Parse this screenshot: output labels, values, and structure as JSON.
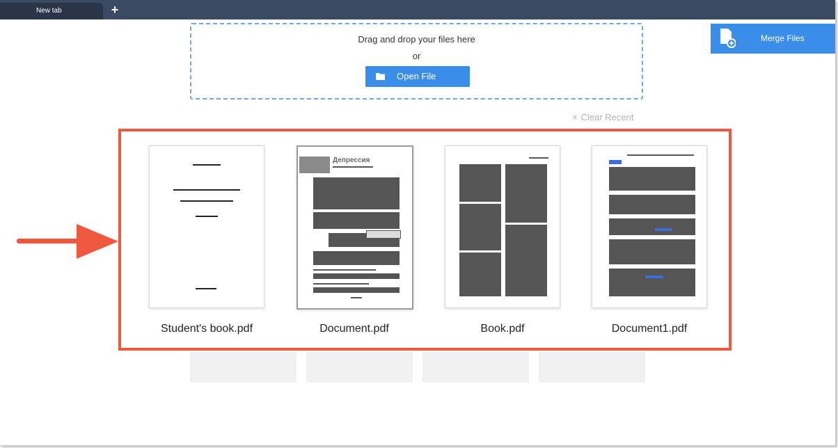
{
  "tabs": [
    {
      "label": "New tab"
    }
  ],
  "tab_add_label": "+",
  "dropzone": {
    "line1": "Drag and drop your files here",
    "line2": "or",
    "open_button": "Open File"
  },
  "merge_button": {
    "label": "Merge Files"
  },
  "clear_recent": {
    "icon": "×",
    "label": "Clear Recent"
  },
  "recent_files": [
    {
      "name": "Student's book.pdf"
    },
    {
      "name": "Document.pdf"
    },
    {
      "name": "Book.pdf"
    },
    {
      "name": "Document1.pdf"
    }
  ],
  "thumbnails": {
    "doc2_heading": "Депрессия"
  },
  "colors": {
    "accent": "#3a8eea",
    "tabbar": "#3b4a63",
    "highlight": "#f0573f",
    "dropzone_border": "#6ea7e6"
  },
  "icons": [
    "plus-icon",
    "folder-icon",
    "merge-file-icon",
    "close-icon",
    "arrow-right-icon"
  ]
}
